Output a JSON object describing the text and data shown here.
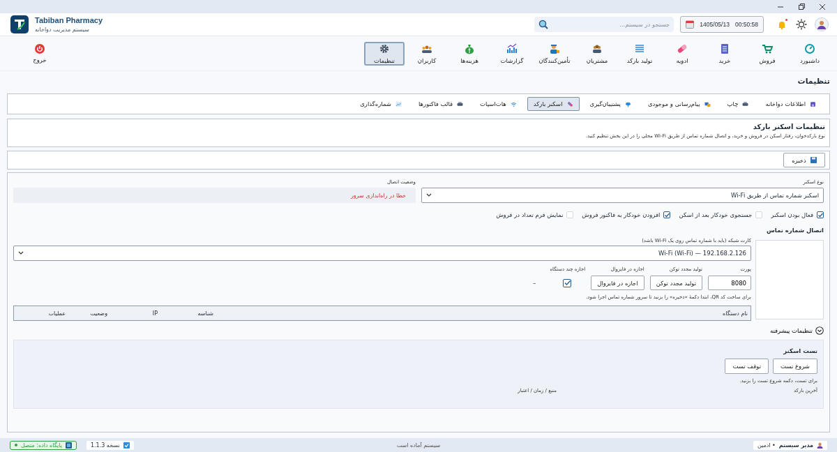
{
  "header": {
    "brand": "Tabiban Pharmacy",
    "subtitle": "سیستم مدیریت دواخانه",
    "search": {
      "placeholder": "جستجو در سیستم..."
    },
    "date": "1405/05/13",
    "time": "00:50:58",
    "notification_unread": true
  },
  "nav": {
    "items": [
      {
        "label": "داشبورد",
        "selected": false
      },
      {
        "label": "فروش",
        "selected": false
      },
      {
        "label": "خرید",
        "selected": false
      },
      {
        "label": "ادویه",
        "selected": false
      },
      {
        "label": "تولید بارکد",
        "selected": false
      },
      {
        "label": "مشتریان",
        "selected": false
      },
      {
        "label": "تأمین‌کنندگان",
        "selected": false
      },
      {
        "label": "گزارشات",
        "selected": false
      },
      {
        "label": "هزینه‌ها",
        "selected": false
      },
      {
        "label": "کاربران",
        "selected": false
      },
      {
        "label": "تنظیمات",
        "selected": true
      }
    ],
    "exit": "خروج"
  },
  "page_title": "تنظیمات",
  "tabs": [
    {
      "label": "اطلاعات دواخانه",
      "selected": false
    },
    {
      "label": "چاپ",
      "selected": false
    },
    {
      "label": "پیام‌رسانی و موجودی",
      "selected": false
    },
    {
      "label": "پشتیبان‌گیری",
      "selected": false
    },
    {
      "label": "اسکنر بارکد",
      "selected": true
    },
    {
      "label": "هات‌اسپات",
      "selected": false
    },
    {
      "label": "قالب فاکتورها",
      "selected": false
    },
    {
      "label": "شماره‌گذاری",
      "selected": false
    }
  ],
  "section": {
    "title": "تنظیمات اسکنر بارکد",
    "description": "نوع بارکدخوان، رفتار اسکن در فروش و خرید، و اتصال شماره تماس از طریق Wi-Fi محلی را در این بخش تنظیم کنید."
  },
  "save_button": "ذخیره",
  "scanner": {
    "type_label": "نوع اسکنر",
    "type_value": "اسکنر شماره تماس از طریق Wi-Fi",
    "status_label": "وضعیت اتصال",
    "status_value": "خطا در راه‌اندازی سرور",
    "status_error": true
  },
  "options": [
    {
      "label": "فعال بودن اسکنر",
      "checked": true
    },
    {
      "label": "جستجوی خودکار بعد از اسکن",
      "checked": false
    },
    {
      "label": "افزودن خودکار به فاکتور فروش",
      "checked": true
    },
    {
      "label": "نمایش فرم تعداد در فروش",
      "checked": false
    }
  ],
  "connection": {
    "heading": "اتصال شماره تماس",
    "network_label": "کارت شبکه (باید با شماره تماس روی یک Wi-Fi باشد)",
    "network_value": "192.168.2.126 — Wi-Fi (Wi-Fi)",
    "port_label": "پورت",
    "port_value": "8080",
    "token_label": "تولید مجدد توکن",
    "token_button": "تولید مجدد توکن",
    "firewall_label": "اجازه در فایروال",
    "firewall_button": "اجازه در فایروال",
    "multi_device_label": "اجازه چند دستگاه",
    "multi_device_checked": true,
    "indicator": "–",
    "hint": "برای ساخت کد QR، ابتدا دکمهٔ «ذخیره» را بزنید تا سرور شماره تماس اجرا شود."
  },
  "devices_table": {
    "columns": [
      "نام دستگاه",
      "شناسه",
      "IP",
      "وضعیت",
      "عملیات"
    ]
  },
  "advanced": {
    "label": "تنظیمات پیشرفته"
  },
  "test": {
    "title": "تست اسکنر",
    "start_button": "شروع تست",
    "stop_button": "توقف تست",
    "hint": "برای تست، دکمه شروع تست را بزنید.",
    "last_label": "آخرین بارکد",
    "last_meta": "منبع / زمان / اعتبار"
  },
  "status_bar": {
    "user": "مدیر سیستم",
    "role": "• ادمین",
    "message": "سیستم آماده است",
    "database": "پایگاه داده: متصل",
    "db_connected": true,
    "version": "نسخه 1.1.3"
  }
}
